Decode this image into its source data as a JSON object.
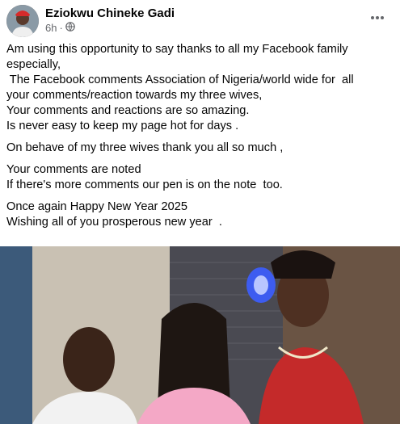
{
  "post": {
    "author": "Eziokwu Chineke Gadi",
    "time": "6h",
    "separator": "·",
    "audience_icon": "globe-icon",
    "more_icon": "more-horizontal-icon",
    "paragraphs": [
      [
        "Am using this opportunity to say thanks to all my Facebook family",
        "especially,",
        " The Facebook comments Association of Nigeria/world wide for  all",
        "your comments/reaction towards my three wives,",
        "Your comments and reactions are so amazing.",
        "Is never easy to keep my page hot for days ."
      ],
      [
        "On behave of my three wives thank you all so much ,"
      ],
      [
        "Your comments are noted",
        "If there's more comments our pen is on the note  too."
      ],
      [
        "Once again Happy New Year 2025",
        "Wishing all of you prosperous new year  ."
      ]
    ]
  },
  "colors": {
    "text": "#050505",
    "secondary": "#65676b"
  }
}
